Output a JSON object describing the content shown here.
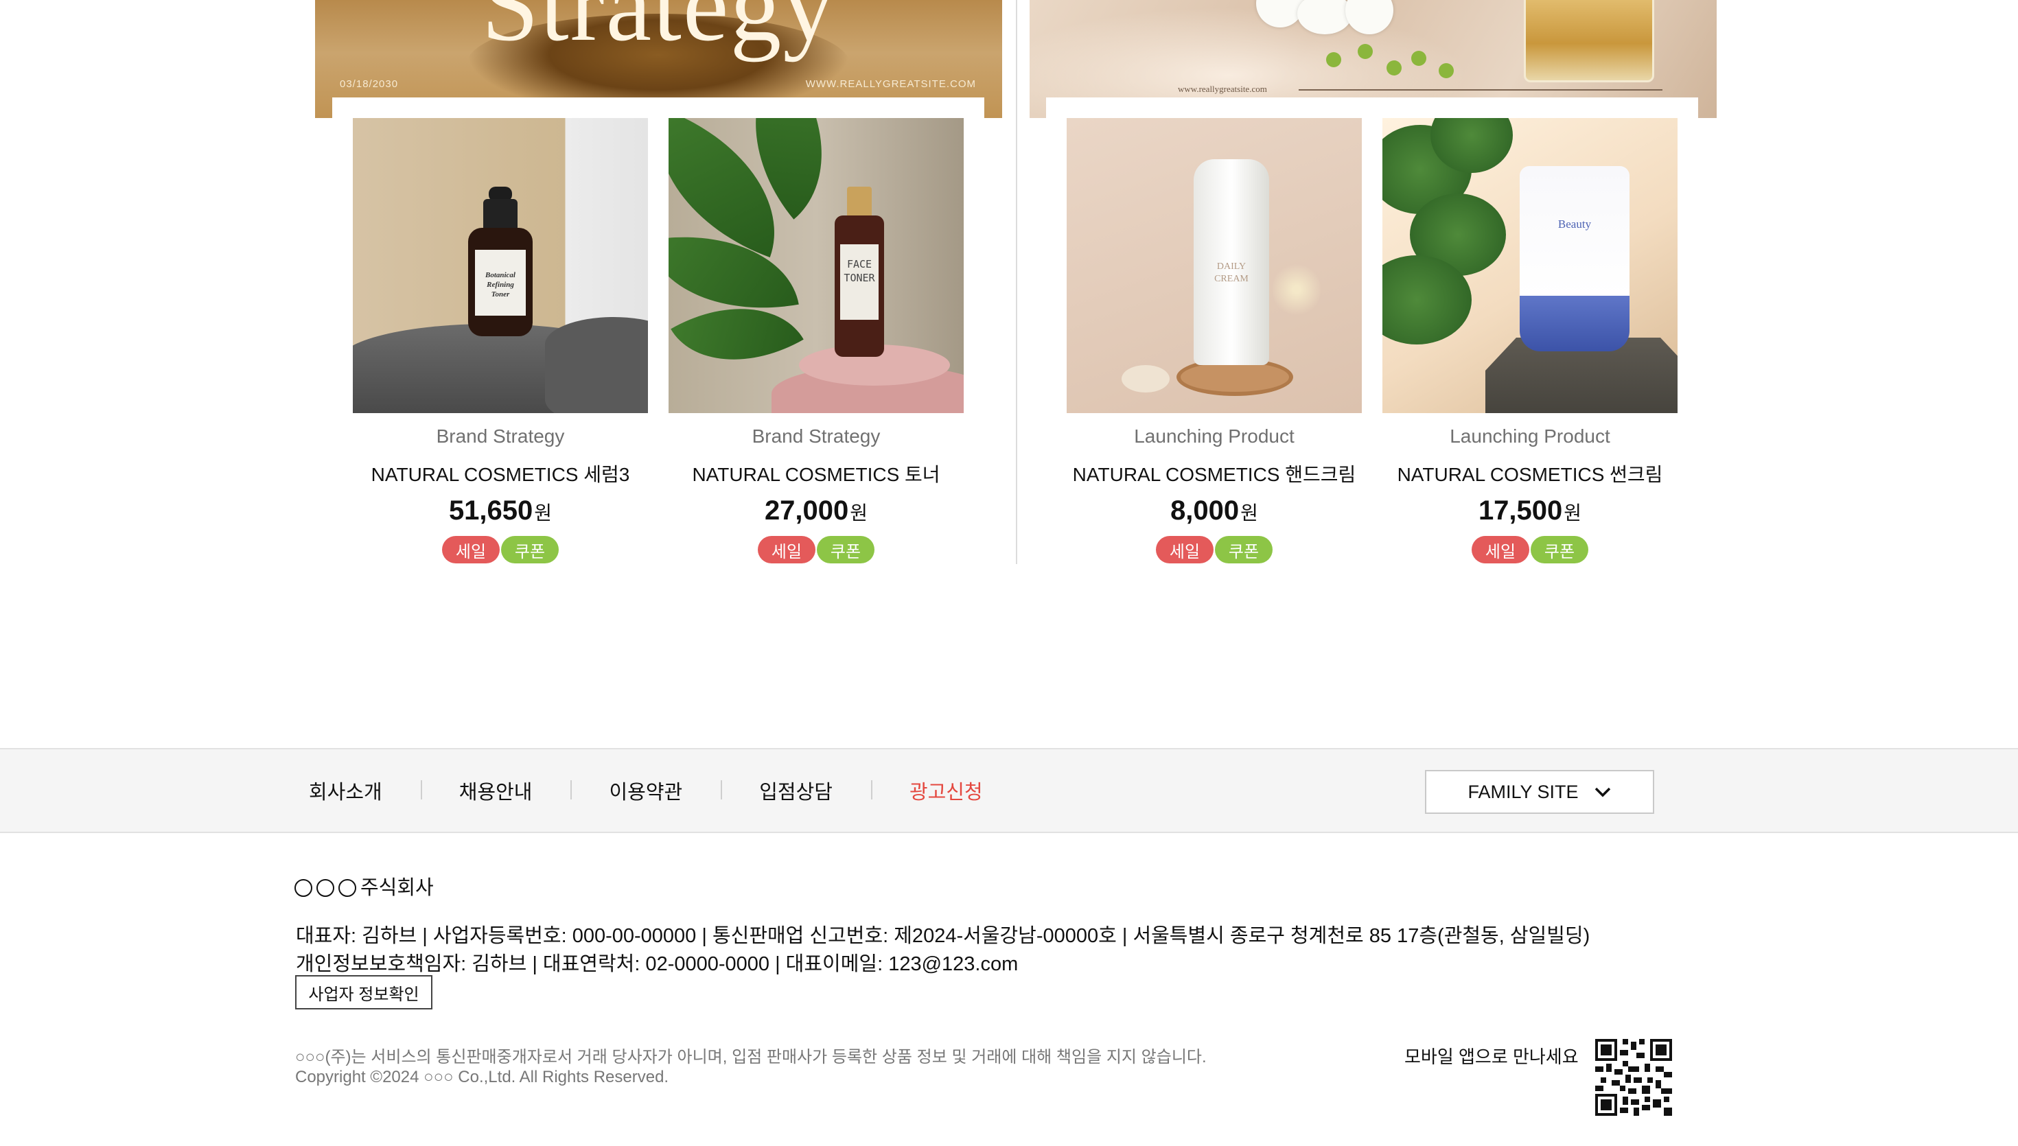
{
  "banners": [
    {
      "title": "Strategy",
      "date": "03/18/2030",
      "url": "WWW.REALLYGREATSITE.COM"
    },
    {
      "url": "www.reallygreatsite.com"
    }
  ],
  "products": [
    {
      "category": "Brand Strategy",
      "name": "NATURAL COSMETICS 세럼3",
      "price": "51,650",
      "currency": "원",
      "badges": [
        "세일",
        "쿠폰"
      ],
      "label_lines": [
        "Botanical",
        "Refining",
        "Toner"
      ]
    },
    {
      "category": "Brand Strategy",
      "name": "NATURAL COSMETICS 토너",
      "price": "27,000",
      "currency": "원",
      "badges": [
        "세일",
        "쿠폰"
      ],
      "label_lines": [
        "FACE",
        "TONER"
      ]
    },
    {
      "category": "Launching Product",
      "name": "NATURAL COSMETICS 핸드크림",
      "price": "8,000",
      "currency": "원",
      "badges": [
        "세일",
        "쿠폰"
      ],
      "label_lines": [
        "DAILY",
        "CREAM"
      ]
    },
    {
      "category": "Launching Product",
      "name": "NATURAL COSMETICS 썬크림",
      "price": "17,500",
      "currency": "원",
      "badges": [
        "세일",
        "쿠폰"
      ],
      "label_lines": [
        "Beauty"
      ]
    }
  ],
  "badge_colors": {
    "sale": "#e45a5a",
    "coupon": "#8dc546"
  },
  "footer": {
    "nav": [
      "회사소개",
      "채용안내",
      "이용약관",
      "입점상담",
      "광고신청"
    ],
    "nav_highlight_color": "#e4483f",
    "family_site": "FAMILY SITE",
    "family_icon": "chevron-down-icon",
    "company_name": "주식회사",
    "info_line1": "대표자: 김하브 | 사업자등록번호: 000-00-00000 | 통신판매업 신고번호: 제2024-서울강남-00000호 | 서울특별시 종로구 청계천로 85 17층(관철동, 삼일빌딩)",
    "info_line2": "개인정보보호책임자: 김하브 | 대표연락처: 02-0000-0000 | 대표이메일: 123@123.com",
    "biz_button": "사업자 정보확인",
    "disclaimer": "○○○(주)는 서비스의 통신판매중개자로서 거래 당사자가 아니며, 입점 판매사가 등록한 상품 정보 및 거래에 대해 책임을 지지 않습니다.",
    "copyright": "Copyright ©2024 ○○○ Co.,Ltd. All Rights Reserved.",
    "mobile_text": "모바일 앱으로 만나세요",
    "qr_icon": "qr-code-icon"
  }
}
